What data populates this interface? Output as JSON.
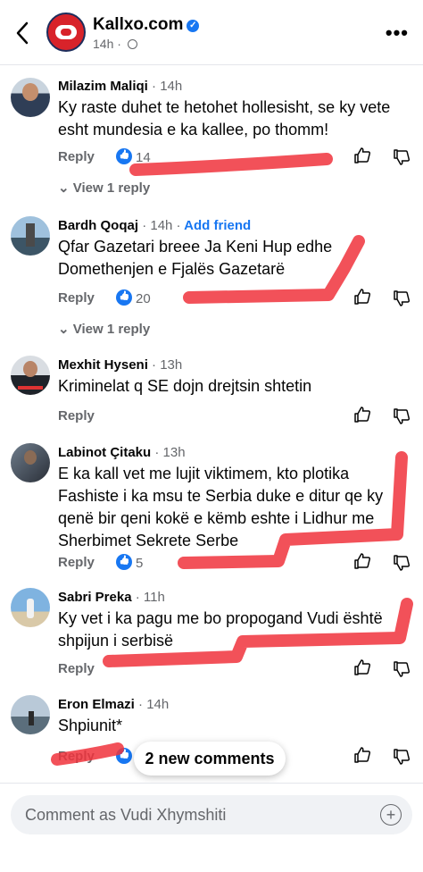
{
  "header": {
    "page_name": "Kallxo.com",
    "meta": "14h · "
  },
  "actions": {
    "reply": "Reply"
  },
  "comments": [
    {
      "author": "Milazim Maliqi",
      "time": "· 14h",
      "text": "Ky raste duhet te hetohet hollesisht, se ky vete esht mundesia e ka kallee, po thomm!",
      "likes": "14",
      "view_replies": "View 1 reply"
    },
    {
      "author": "Bardh Qoqaj",
      "time": "· 14h ·",
      "add_friend": "Add friend",
      "text": "Qfar Gazetari breee Ja Keni Hup edhe Domethenjen e Fjalës Gazetarë",
      "likes": "20",
      "view_replies": "View 1 reply"
    },
    {
      "author": "Mexhit Hyseni",
      "time": "· 13h",
      "text": "Kriminelat q SE dojn drejtsin shtetin"
    },
    {
      "author": "Labinot Çitaku",
      "time": "· 13h",
      "text": "E ka kall vet me lujit viktimem, kto plotika Fashiste i ka msu te Serbia duke e ditur qe ky qenë bir qeni kokë e këmb eshte i Lidhur me Sherbimet Sekrete Serbe",
      "likes": "5"
    },
    {
      "author": "Sabri Preka",
      "time": "· 11h",
      "text": "Ky vet i ka pagu me bo propogand  Vudi është shpijun i serbisë"
    },
    {
      "author": "Eron Elmazi",
      "time": "· 14h",
      "text": "Shpiunit*"
    }
  ],
  "new_comments": "2 new comments",
  "composer_placeholder": "Comment as Vudi Xhymshiti"
}
